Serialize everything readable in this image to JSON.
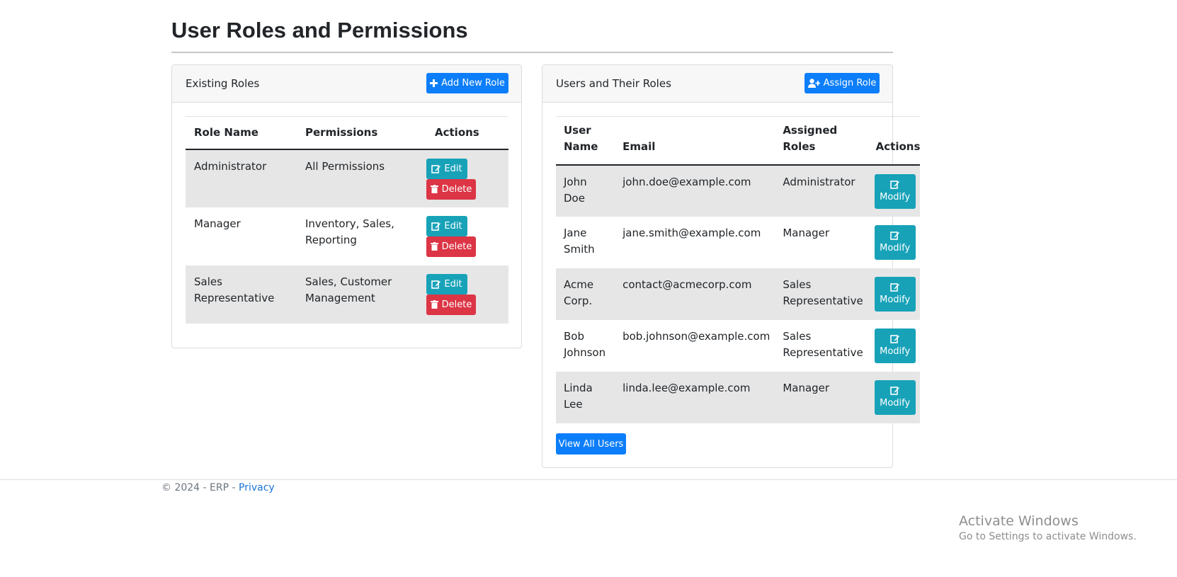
{
  "page": {
    "title": "User Roles and Permissions"
  },
  "roles_card": {
    "title": "Existing Roles",
    "add_button": "Add New Role",
    "columns": [
      "Role Name",
      "Permissions",
      "Actions"
    ],
    "rows": [
      {
        "name": "Administrator",
        "permissions": "All Permissions"
      },
      {
        "name": "Manager",
        "permissions": "Inventory, Sales, Reporting"
      },
      {
        "name": "Sales Representative",
        "permissions": "Sales, Customer Management"
      }
    ],
    "edit_label": "Edit",
    "delete_label": "Delete"
  },
  "users_card": {
    "title": "Users and Their Roles",
    "assign_button": "Assign Role",
    "columns": [
      "User Name",
      "Email",
      "Assigned Roles",
      "Actions"
    ],
    "rows": [
      {
        "name": "John Doe",
        "email": "john.doe@example.com",
        "role": "Administrator"
      },
      {
        "name": "Jane Smith",
        "email": "jane.smith@example.com",
        "role": "Manager"
      },
      {
        "name": "Acme Corp.",
        "email": "contact@acmecorp.com",
        "role": "Sales Representative"
      },
      {
        "name": "Bob Johnson",
        "email": "bob.johnson@example.com",
        "role": "Sales Representative"
      },
      {
        "name": "Linda Lee",
        "email": "linda.lee@example.com",
        "role": "Manager"
      }
    ],
    "modify_label": "Modify",
    "view_all_button": "View All Users"
  },
  "footer": {
    "text": "© 2024 - ERP - ",
    "privacy_link": "Privacy"
  },
  "watermark": {
    "line1": "Activate Windows",
    "line2": "Go to Settings to activate Windows."
  },
  "colors": {
    "primary": "#0d7ef9",
    "info": "#17a2b8",
    "danger": "#dc3545",
    "stripe": "#e6e6e6"
  }
}
